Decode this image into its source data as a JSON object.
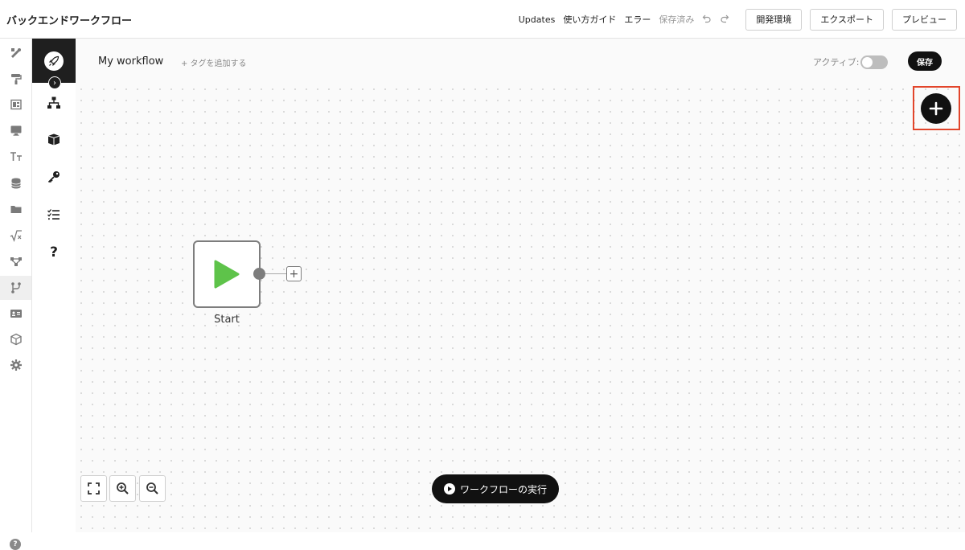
{
  "header": {
    "app_title": "バックエンドワークフロー",
    "links": {
      "updates": "Updates",
      "guide": "使い方ガイド",
      "errors": "エラー",
      "saved": "保存済み"
    },
    "buttons": {
      "dev_env": "開発環境",
      "export": "エクスポート",
      "preview": "プレビュー"
    }
  },
  "rail": {
    "icons": [
      "design-icon",
      "paint-roller-icon",
      "layout-icon",
      "desktop-icon",
      "text-icon",
      "database-icon",
      "folder-icon",
      "formula-icon",
      "network-icon",
      "workflow-branch-icon",
      "id-card-icon",
      "cube-icon",
      "gear-icon"
    ],
    "active": "workflow-branch-icon"
  },
  "panel": {
    "icons": [
      "sitemap-icon",
      "box-icon",
      "key-icon",
      "checklist-icon",
      "question-icon"
    ]
  },
  "workflow": {
    "name": "My workflow",
    "add_tag": "+ タグを追加する",
    "active_label": "アクティブ:",
    "active": false,
    "save_label": "保存"
  },
  "node": {
    "label": "Start",
    "accent": "#5ec34a"
  },
  "footer": {
    "run_label": "ワークフローの実行"
  },
  "colors": {
    "highlight": "#e2452b",
    "dark": "#111111"
  }
}
